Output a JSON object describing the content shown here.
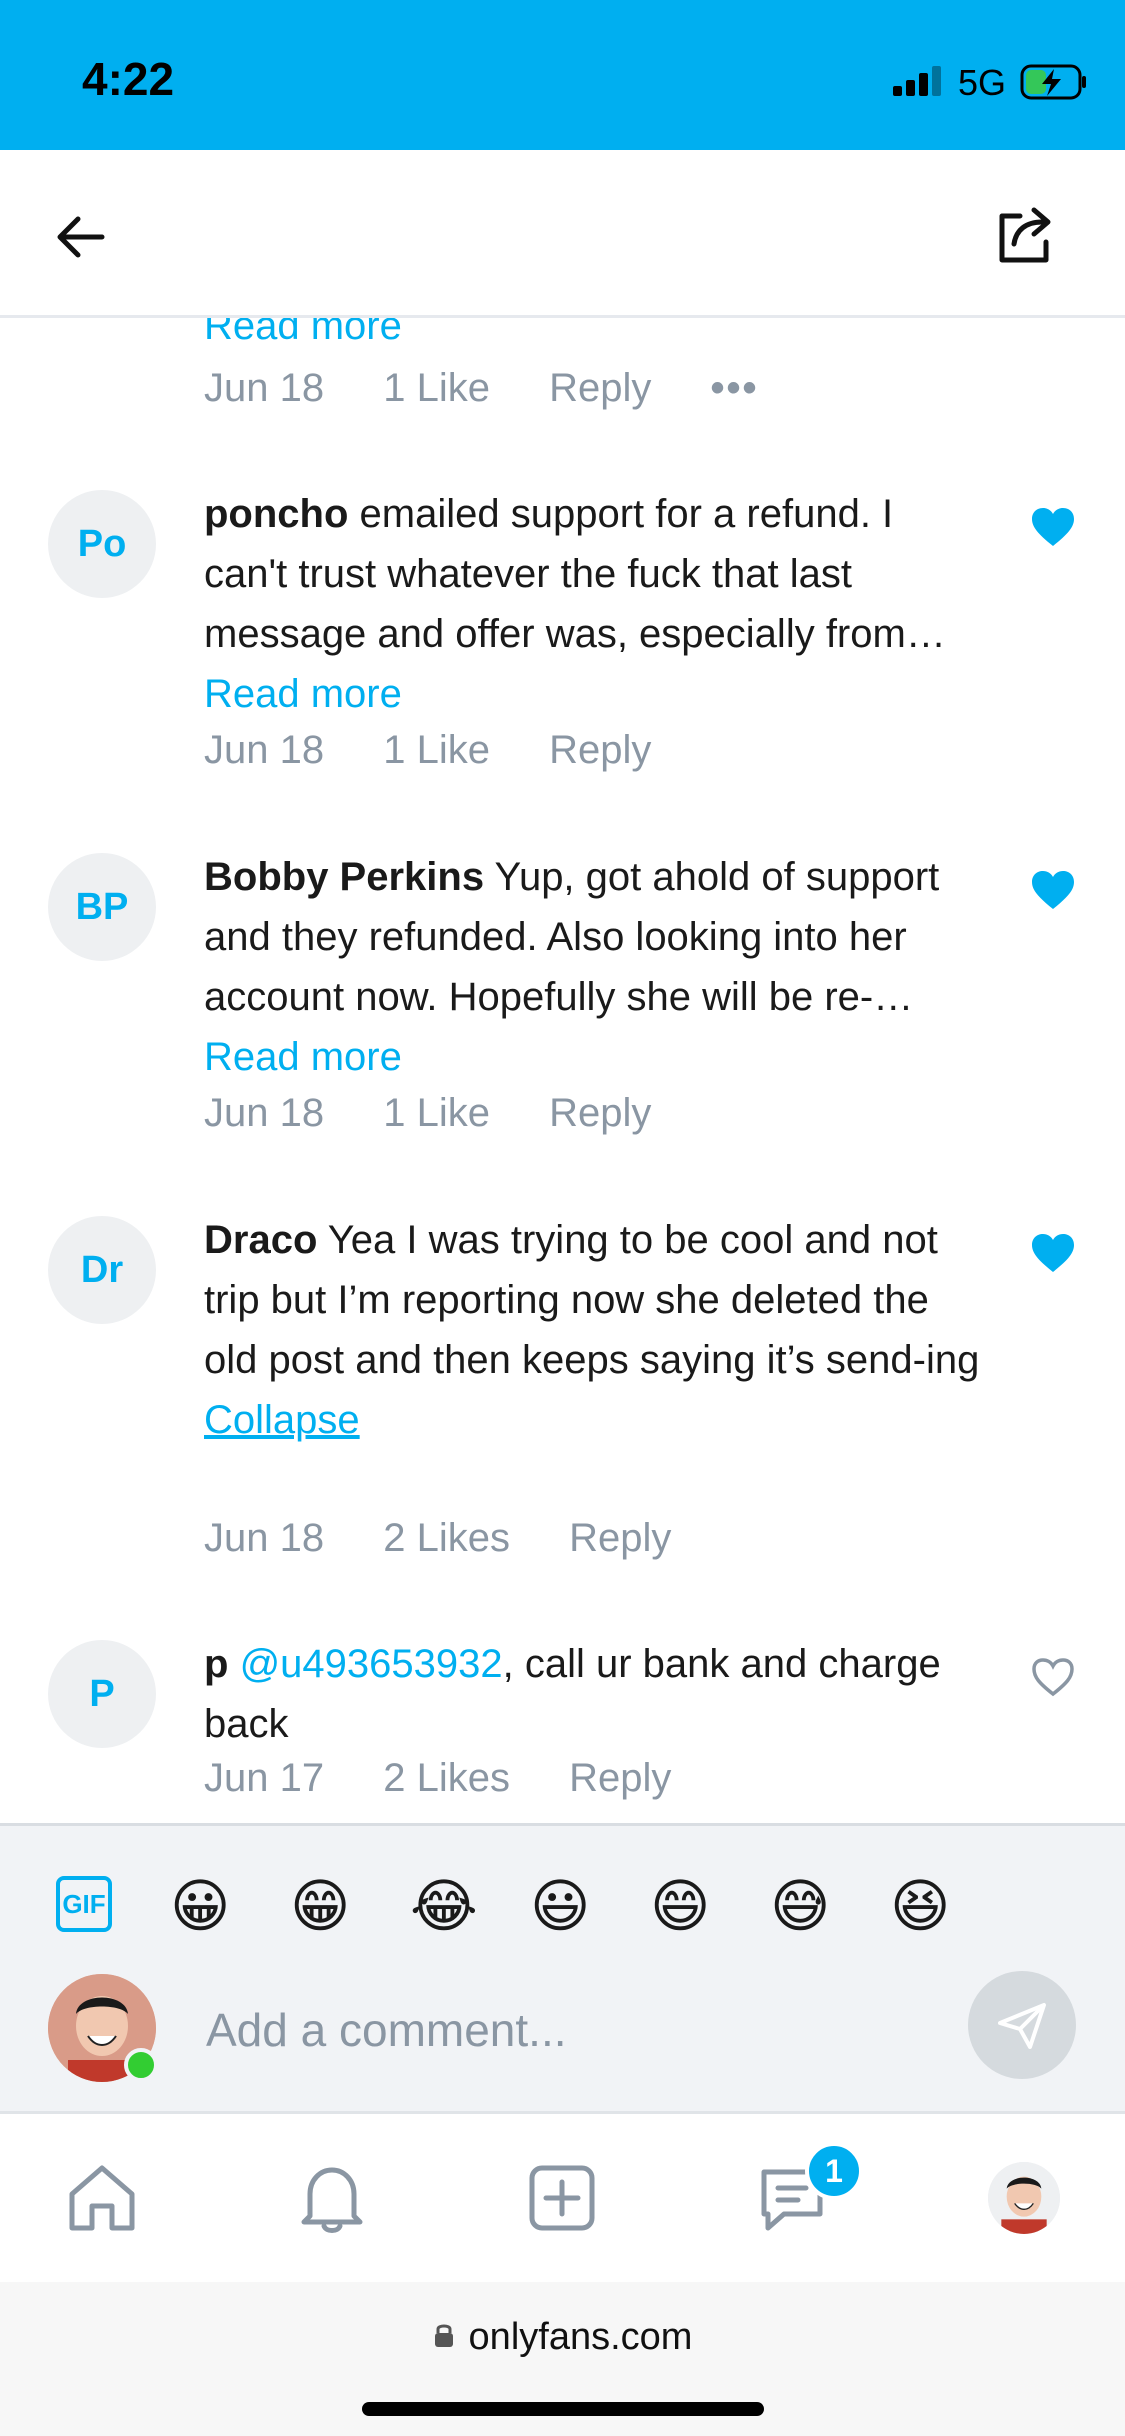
{
  "status_bar": {
    "time": "4:22",
    "network": "5G"
  },
  "comments_top": {
    "partial_read_more": "Read more",
    "date": "Jun 18",
    "likes": "1 Like",
    "reply": "Reply",
    "more": "•••"
  },
  "comments": [
    {
      "avatar": "Po",
      "username": "poncho",
      "text": " emailed support for a refund. I can't trust whatever the fuck that last message and offer was, especially from…",
      "link": "Read more",
      "date": "Jun 18",
      "likes": "1 Like",
      "reply": "Reply",
      "liked": true
    },
    {
      "avatar": "BP",
      "username": "Bobby Perkins",
      "text": " Yup, got ahold of support and they refunded. Also looking into her account now. Hopefully she will be re-…",
      "link": "Read more",
      "date": "Jun 18",
      "likes": "1 Like",
      "reply": "Reply",
      "liked": true
    },
    {
      "avatar": "Dr",
      "username": "Draco",
      "text": " Yea I was trying to be cool and not trip but I’m reporting now she deleted the old post and then keeps saying it’s send-ing",
      "link": "Collapse",
      "date": "Jun 18",
      "likes": "2 Likes",
      "reply": "Reply",
      "liked": true
    },
    {
      "avatar": "P",
      "username": "p",
      "mention": "@u493653932",
      "text": ", call ur bank and charge back",
      "date": "Jun 17",
      "likes": "2 Likes",
      "reply": "Reply",
      "liked": false
    }
  ],
  "composer": {
    "gif_label": "GIF",
    "emojis": [
      "😀",
      "😁",
      "😂",
      "😃",
      "😄",
      "😅",
      "😆"
    ],
    "placeholder": "Add a comment..."
  },
  "bottom_nav": {
    "messages_badge": "1"
  },
  "url_bar": {
    "url": "onlyfans.com"
  },
  "colors": {
    "accent": "#00aff0",
    "meta_gray": "#8a96a3"
  }
}
